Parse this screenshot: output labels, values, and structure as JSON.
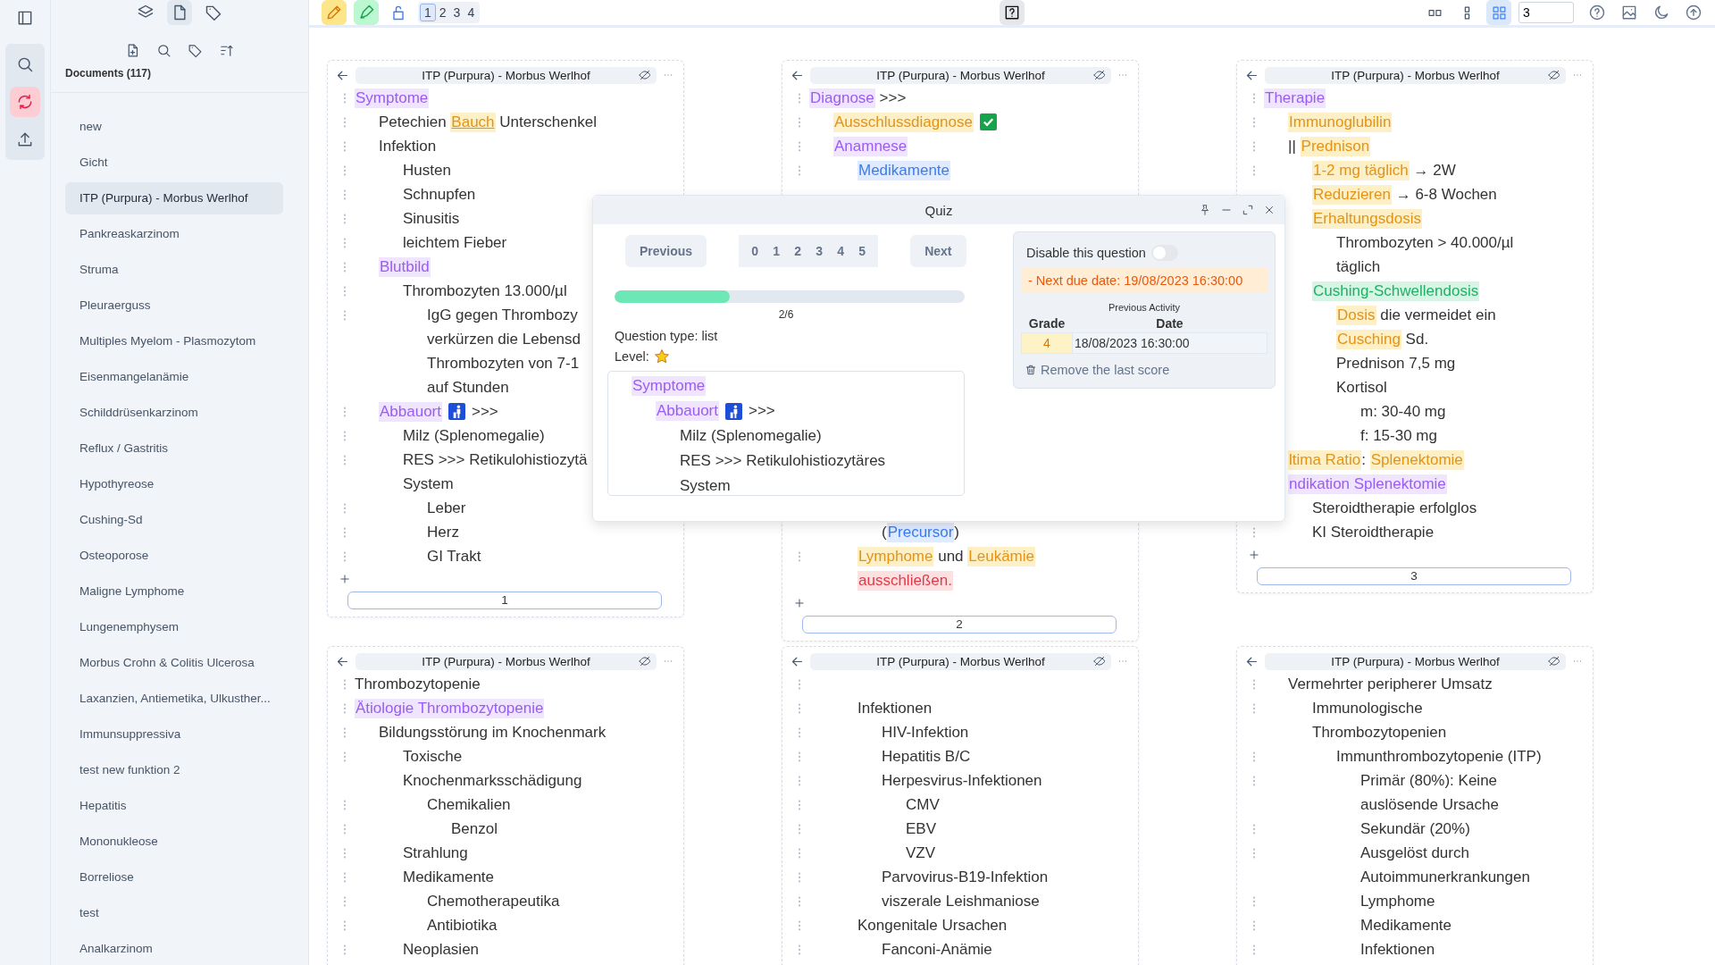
{
  "rail_tools": [
    {
      "kind": "search",
      "selected": false
    },
    {
      "kind": "refresh",
      "selected": true
    },
    {
      "kind": "upload",
      "selected": false
    }
  ],
  "list_tabs": [
    {
      "kind": "layers",
      "selected": false
    },
    {
      "kind": "document",
      "selected": true
    },
    {
      "kind": "tag",
      "selected": false
    }
  ],
  "list_tools": [
    {
      "kind": "document-plus"
    },
    {
      "kind": "search"
    },
    {
      "kind": "tag"
    },
    {
      "kind": "sort"
    }
  ],
  "documents_heading": "Documents (117)",
  "documents": [
    {
      "label": "new",
      "selected": false
    },
    {
      "label": "Gicht",
      "selected": false
    },
    {
      "label": "ITP (Purpura) - Morbus Werlhof",
      "selected": true
    },
    {
      "label": "Pankreaskarzinom",
      "selected": false
    },
    {
      "label": "Struma",
      "selected": false
    },
    {
      "label": "Pleuraerguss",
      "selected": false
    },
    {
      "label": "Multiples Myelom - Plasmozytom",
      "selected": false
    },
    {
      "label": "Eisenmangelanämie",
      "selected": false
    },
    {
      "label": "Schilddrüsenkarzinom",
      "selected": false
    },
    {
      "label": "Reflux / Gastritis",
      "selected": false
    },
    {
      "label": "Hypothyreose",
      "selected": false
    },
    {
      "label": "Cushing-Sd",
      "selected": false
    },
    {
      "label": "Osteoporose",
      "selected": false
    },
    {
      "label": "Maligne Lymphome",
      "selected": false
    },
    {
      "label": "Lungenemphysem",
      "selected": false
    },
    {
      "label": "Morbus Crohn & Colitis Ulcerosa",
      "selected": false
    },
    {
      "label": "Laxanzien, Antiemetika, Ulkusther...",
      "selected": false
    },
    {
      "label": "Immunsuppressiva",
      "selected": false
    },
    {
      "label": "test new funktion 2",
      "selected": false
    },
    {
      "label": "Hepatitis",
      "selected": false
    },
    {
      "label": "Mononukleose",
      "selected": false
    },
    {
      "label": "Borreliose",
      "selected": false
    },
    {
      "label": "test",
      "selected": false
    },
    {
      "label": "Analkarzinom",
      "selected": false
    }
  ],
  "editor_tools": [
    {
      "kind": "pencil"
    },
    {
      "kind": "marker"
    },
    {
      "kind": "lock"
    }
  ],
  "pages": [
    {
      "label": "1",
      "selected": true
    },
    {
      "label": "2",
      "selected": false
    },
    {
      "label": "3",
      "selected": false
    },
    {
      "label": "4",
      "selected": false
    }
  ],
  "layouts": [
    {
      "kind": "layout-split",
      "selected": false
    },
    {
      "kind": "layout-stack",
      "selected": false
    },
    {
      "kind": "layout-grid",
      "selected": true
    }
  ],
  "columns_value": "3",
  "right_tools": [
    {
      "kind": "help"
    },
    {
      "kind": "image"
    },
    {
      "kind": "moon"
    },
    {
      "kind": "upload-circle"
    }
  ],
  "panels": [
    {
      "title": "ITP (Purpura) - Morbus Werlhof",
      "show_add": true,
      "page": "1",
      "outline": [
        {
          "handle": true,
          "parts": [
            {
              "text": "Symptome",
              "kind": "purple"
            }
          ],
          "children": [
            {
              "handle": true,
              "parts": [
                {
                  "text": "Petechien ",
                  "kind": "plain"
                },
                {
                  "text": "Bauch",
                  "kind": "underline"
                },
                {
                  "text": " Unterschenkel",
                  "kind": "plain"
                }
              ]
            },
            {
              "handle": true,
              "parts": [
                {
                  "text": "Infektion",
                  "kind": "plain"
                }
              ],
              "children": [
                {
                  "handle": true,
                  "parts": [
                    {
                      "text": "Husten",
                      "kind": "plain"
                    }
                  ]
                },
                {
                  "handle": true,
                  "parts": [
                    {
                      "text": "Schnupfen",
                      "kind": "plain"
                    }
                  ]
                },
                {
                  "handle": true,
                  "parts": [
                    {
                      "text": "Sinusitis",
                      "kind": "plain"
                    }
                  ]
                },
                {
                  "handle": true,
                  "parts": [
                    {
                      "text": "leichtem Fieber",
                      "kind": "plain"
                    }
                  ]
                }
              ]
            },
            {
              "handle": true,
              "parts": [
                {
                  "text": "Blutbild",
                  "kind": "purple"
                }
              ],
              "children": [
                {
                  "handle": true,
                  "parts": [
                    {
                      "text": "Thrombozyten 13.000/µl",
                      "kind": "plain"
                    }
                  ],
                  "children": [
                    {
                      "handle": true,
                      "parts": [
                        {
                          "text": "IgG gegen Thrombozy",
                          "kind": "plain"
                        }
                      ]
                    },
                    {
                      "handle": false,
                      "parts": [
                        {
                          "text": "verkürzen die Lebensd",
                          "kind": "plain"
                        }
                      ]
                    },
                    {
                      "handle": false,
                      "parts": [
                        {
                          "text": "Thrombozyten von 7-1",
                          "kind": "plain"
                        }
                      ]
                    },
                    {
                      "handle": false,
                      "parts": [
                        {
                          "text": "auf Stunden",
                          "kind": "plain"
                        }
                      ]
                    }
                  ]
                }
              ]
            },
            {
              "handle": true,
              "parts": [
                {
                  "text": "Abbauort",
                  "kind": "purple"
                },
                {
                  "kind": "litter"
                },
                {
                  "text": ">>>",
                  "kind": "plain"
                }
              ],
              "children": [
                {
                  "handle": true,
                  "parts": [
                    {
                      "text": "Milz (Splenomegalie)",
                      "kind": "plain"
                    }
                  ]
                },
                {
                  "handle": true,
                  "parts": [
                    {
                      "text": "RES >>> Retikulohistiozytä",
                      "kind": "plain"
                    }
                  ]
                },
                {
                  "handle": false,
                  "parts": [
                    {
                      "text": "System",
                      "kind": "plain"
                    }
                  ],
                  "children": [
                    {
                      "handle": true,
                      "parts": [
                        {
                          "text": "Leber",
                          "kind": "plain"
                        }
                      ]
                    },
                    {
                      "handle": true,
                      "parts": [
                        {
                          "text": "Herz",
                          "kind": "plain"
                        }
                      ]
                    },
                    {
                      "handle": true,
                      "parts": [
                        {
                          "text": "GI Trakt",
                          "kind": "plain"
                        }
                      ]
                    }
                  ]
                }
              ]
            }
          ]
        }
      ]
    },
    {
      "title": "ITP (Purpura) - Morbus Werlhof",
      "show_add": true,
      "page": "2",
      "outline": [
        {
          "handle": true,
          "parts": [
            {
              "text": "Diagnose",
              "kind": "purple"
            },
            {
              "text": " >>>",
              "kind": "plain"
            }
          ],
          "children": [
            {
              "handle": true,
              "parts": [
                {
                  "text": "Ausschlussdiagnose",
                  "kind": "orange"
                },
                {
                  "kind": "check"
                }
              ]
            },
            {
              "handle": true,
              "parts": [
                {
                  "text": "Anamnese",
                  "kind": "purple"
                }
              ],
              "children": [
                {
                  "handle": true,
                  "parts": [
                    {
                      "text": "Medikamente",
                      "kind": "blue"
                    }
                  ]
                }
              ]
            }
          ]
        },
        {
          "children": [
            {
              "children": [
                {
                  "children": [
                    {
                      "handle": false,
                      "parts": [
                        {
                          "text": "(",
                          "kind": "plain"
                        },
                        {
                          "text": "Precursor",
                          "kind": "blue"
                        },
                        {
                          "text": ")",
                          "kind": "plain"
                        }
                      ]
                    }
                  ]
                },
                {
                  "handle": true,
                  "parts": [
                    {
                      "text": "Lymphome",
                      "kind": "orange"
                    },
                    {
                      "text": " und ",
                      "kind": "plain"
                    },
                    {
                      "text": "Leukämie",
                      "kind": "orange"
                    }
                  ]
                },
                {
                  "handle": false,
                  "parts": [
                    {
                      "text": "ausschließen.",
                      "kind": "red"
                    }
                  ]
                }
              ]
            }
          ]
        }
      ]
    },
    {
      "title": "ITP (Purpura) - Morbus Werlhof",
      "show_add": true,
      "page": "3",
      "outline": [
        {
          "handle": true,
          "parts": [
            {
              "text": "Therapie",
              "kind": "purple"
            }
          ],
          "children": [
            {
              "handle": true,
              "parts": [
                {
                  "text": "Immunoglubilin",
                  "kind": "orange"
                }
              ]
            },
            {
              "handle": true,
              "parts": [
                {
                  "text": "|| ",
                  "kind": "plain"
                },
                {
                  "text": "Prednison",
                  "kind": "orange"
                }
              ],
              "children": [
                {
                  "handle": true,
                  "parts": [
                    {
                      "text": "1-2 mg täglich",
                      "kind": "orange"
                    },
                    {
                      "text": " → 2W",
                      "kind": "plain"
                    }
                  ]
                },
                {
                  "handle": false,
                  "parts": [
                    {
                      "text": "Reduzieren",
                      "kind": "orange"
                    },
                    {
                      "text": " → 6-8 Wochen",
                      "kind": "plain"
                    }
                  ]
                },
                {
                  "handle": false,
                  "parts": [
                    {
                      "text": "Erhaltungsdosis",
                      "kind": "orange"
                    }
                  ],
                  "children": [
                    {
                      "handle": false,
                      "parts": [
                        {
                          "text": "Thrombozyten > 40.000/µl",
                          "kind": "plain"
                        }
                      ]
                    },
                    {
                      "handle": false,
                      "parts": [
                        {
                          "text": "täglich",
                          "kind": "plain"
                        }
                      ]
                    }
                  ]
                },
                {
                  "handle": false,
                  "parts": [
                    {
                      "text": "Cushing-Schwellendosis",
                      "kind": "green"
                    }
                  ],
                  "children": [
                    {
                      "handle": false,
                      "parts": [
                        {
                          "text": "Dosis",
                          "kind": "orange"
                        },
                        {
                          "text": " die vermeidet ein",
                          "kind": "plain"
                        }
                      ]
                    },
                    {
                      "handle": false,
                      "parts": [
                        {
                          "text": "Cusching",
                          "kind": "orange"
                        },
                        {
                          "text": " Sd.",
                          "kind": "plain"
                        }
                      ]
                    },
                    {
                      "handle": false,
                      "parts": [
                        {
                          "text": "Prednison 7,5 mg",
                          "kind": "plain"
                        }
                      ]
                    },
                    {
                      "handle": false,
                      "parts": [
                        {
                          "text": "Kortisol",
                          "kind": "plain"
                        }
                      ],
                      "children": [
                        {
                          "handle": false,
                          "parts": [
                            {
                              "text": "m: 30-40 mg",
                              "kind": "plain"
                            }
                          ]
                        },
                        {
                          "handle": false,
                          "parts": [
                            {
                              "text": "f: 15-30 mg",
                              "kind": "plain"
                            }
                          ]
                        }
                      ]
                    }
                  ]
                }
              ]
            },
            {
              "handle": false,
              "parts": [
                {
                  "text": "ltima Ratio",
                  "kind": "orange"
                },
                {
                  "text": ": ",
                  "kind": "plain"
                },
                {
                  "text": "Splenektomie",
                  "kind": "orange"
                }
              ]
            },
            {
              "handle": false,
              "parts": [
                {
                  "text": "ndikation Splenektomie",
                  "kind": "purple"
                }
              ],
              "children": [
                {
                  "handle": false,
                  "parts": [
                    {
                      "text": "Steroidtherapie erfolglos",
                      "kind": "plain"
                    }
                  ]
                },
                {
                  "handle": true,
                  "parts": [
                    {
                      "text": "KI Steroidtherapie",
                      "kind": "plain"
                    }
                  ]
                }
              ]
            }
          ]
        }
      ]
    },
    {
      "title": "ITP (Purpura) - Morbus Werlhof",
      "show_add": false,
      "outline": [
        {
          "handle": true,
          "parts": [
            {
              "text": "Thrombozytopenie",
              "kind": "plain"
            }
          ]
        },
        {
          "handle": true,
          "parts": [
            {
              "text": "Ätiologie Thrombozytopenie",
              "kind": "purple"
            }
          ],
          "children": [
            {
              "handle": true,
              "parts": [
                {
                  "text": "Bildungsstörung im Knochenmark",
                  "kind": "plain"
                }
              ],
              "children": [
                {
                  "handle": true,
                  "parts": [
                    {
                      "text": "Toxische",
                      "kind": "plain"
                    }
                  ]
                },
                {
                  "handle": false,
                  "parts": [
                    {
                      "text": "Knochenmarksschädigung",
                      "kind": "plain"
                    }
                  ],
                  "children": [
                    {
                      "handle": true,
                      "parts": [
                        {
                          "text": "Chemikalien",
                          "kind": "plain"
                        }
                      ],
                      "children": [
                        {
                          "handle": true,
                          "parts": [
                            {
                              "text": "Benzol",
                              "kind": "plain"
                            }
                          ]
                        }
                      ]
                    }
                  ]
                },
                {
                  "handle": true,
                  "parts": [
                    {
                      "text": "Strahlung",
                      "kind": "plain"
                    }
                  ]
                },
                {
                  "handle": true,
                  "parts": [
                    {
                      "text": "Medikamente",
                      "kind": "plain"
                    }
                  ],
                  "children": [
                    {
                      "handle": true,
                      "parts": [
                        {
                          "text": "Chemotherapeutika",
                          "kind": "plain"
                        }
                      ]
                    },
                    {
                      "handle": true,
                      "parts": [
                        {
                          "text": "Antibiotika",
                          "kind": "plain"
                        }
                      ]
                    }
                  ]
                },
                {
                  "handle": true,
                  "parts": [
                    {
                      "text": "Neoplasien",
                      "kind": "plain"
                    }
                  ]
                }
              ]
            }
          ]
        }
      ]
    },
    {
      "title": "ITP (Purpura) - Morbus Werlhof",
      "show_add": false,
      "outline": [
        {
          "handle": true,
          "children": [
            {
              "children": [
                {
                  "handle": true,
                  "parts": [
                    {
                      "text": "Infektionen",
                      "kind": "plain"
                    }
                  ],
                  "children": [
                    {
                      "handle": true,
                      "parts": [
                        {
                          "text": "HIV-Infektion",
                          "kind": "plain"
                        }
                      ]
                    },
                    {
                      "handle": true,
                      "parts": [
                        {
                          "text": "Hepatitis B/C",
                          "kind": "plain"
                        }
                      ]
                    },
                    {
                      "handle": true,
                      "parts": [
                        {
                          "text": "Herpesvirus-Infektionen",
                          "kind": "plain"
                        }
                      ],
                      "children": [
                        {
                          "handle": true,
                          "parts": [
                            {
                              "text": "CMV",
                              "kind": "plain"
                            }
                          ]
                        },
                        {
                          "handle": true,
                          "parts": [
                            {
                              "text": "EBV",
                              "kind": "plain"
                            }
                          ]
                        },
                        {
                          "handle": true,
                          "parts": [
                            {
                              "text": "VZV",
                              "kind": "plain"
                            }
                          ]
                        }
                      ]
                    },
                    {
                      "handle": true,
                      "parts": [
                        {
                          "text": "Parvovirus-B19-Infektion",
                          "kind": "plain"
                        }
                      ]
                    },
                    {
                      "handle": true,
                      "parts": [
                        {
                          "text": "viszerale Leishmaniose",
                          "kind": "plain"
                        }
                      ]
                    }
                  ]
                },
                {
                  "handle": true,
                  "parts": [
                    {
                      "text": "Kongenitale Ursachen",
                      "kind": "plain"
                    }
                  ],
                  "children": [
                    {
                      "handle": true,
                      "parts": [
                        {
                          "text": "Fanconi-Anämie",
                          "kind": "plain"
                        }
                      ]
                    }
                  ]
                }
              ]
            }
          ]
        }
      ]
    },
    {
      "title": "ITP (Purpura) - Morbus Werlhof",
      "show_add": false,
      "outline": [
        {
          "children": [
            {
              "handle": true,
              "parts": [
                {
                  "text": "Vermehrter peripherer Umsatz",
                  "kind": "plain"
                }
              ],
              "children": [
                {
                  "handle": true,
                  "parts": [
                    {
                      "text": "Immunologische",
                      "kind": "plain"
                    }
                  ]
                },
                {
                  "handle": false,
                  "parts": [
                    {
                      "text": "Thrombozytopenien",
                      "kind": "plain"
                    }
                  ],
                  "children": [
                    {
                      "handle": true,
                      "parts": [
                        {
                          "text": "Immunthrombozytopenie (ITP)",
                          "kind": "plain"
                        }
                      ],
                      "children": [
                        {
                          "handle": true,
                          "parts": [
                            {
                              "text": "Primär (80%): Keine",
                              "kind": "plain"
                            }
                          ]
                        },
                        {
                          "handle": false,
                          "parts": [
                            {
                              "text": "auslösende Ursache",
                              "kind": "plain"
                            }
                          ]
                        },
                        {
                          "handle": true,
                          "parts": [
                            {
                              "text": "Sekundär (20%)",
                              "kind": "plain"
                            }
                          ]
                        },
                        {
                          "handle": true,
                          "parts": [
                            {
                              "text": "Ausgelöst durch",
                              "kind": "plain"
                            }
                          ]
                        },
                        {
                          "handle": false,
                          "parts": [
                            {
                              "text": "Autoimmunerkrankungen",
                              "kind": "plain"
                            }
                          ]
                        },
                        {
                          "handle": true,
                          "parts": [
                            {
                              "text": "Lymphome",
                              "kind": "plain"
                            }
                          ]
                        },
                        {
                          "handle": true,
                          "parts": [
                            {
                              "text": "Medikamente",
                              "kind": "plain"
                            }
                          ]
                        },
                        {
                          "handle": true,
                          "parts": [
                            {
                              "text": "Infektionen",
                              "kind": "plain"
                            }
                          ]
                        }
                      ]
                    }
                  ]
                }
              ]
            }
          ]
        }
      ]
    }
  ],
  "quiz": {
    "title": "Quiz",
    "previous": "Previous",
    "next": "Next",
    "grades": [
      "0",
      "1",
      "2",
      "3",
      "4",
      "5"
    ],
    "progress": {
      "level": 0.33,
      "label": "2/6"
    },
    "question_type": "Question type: list",
    "level_label": "Level:",
    "preview": [
      {
        "parts": [
          {
            "text": "Symptome",
            "kind": "purple"
          }
        ],
        "children": [
          {
            "parts": [
              {
                "text": "Abbauort",
                "kind": "purple"
              },
              {
                "kind": "litter"
              },
              {
                "text": ">>>",
                "kind": "plain"
              }
            ],
            "children": [
              {
                "parts": [
                  {
                    "text": "Milz (Splenomegalie)",
                    "kind": "plain"
                  }
                ]
              },
              {
                "parts": [
                  {
                    "text": "RES >>> Retikulohistiozytäres",
                    "kind": "plain"
                  }
                ]
              },
              {
                "parts": [
                  {
                    "text": "System",
                    "kind": "plain"
                  }
                ]
              }
            ]
          }
        ]
      }
    ],
    "disable": {
      "label": "Disable this question",
      "on": false
    },
    "due": "- Next due date: 19/08/2023 16:30:00",
    "activity": {
      "title": "Previous Activity",
      "columns": [
        "Grade",
        "Date"
      ],
      "rows": [
        [
          "4",
          "18/08/2023 16:30:00"
        ]
      ]
    },
    "remove": "Remove the last score"
  }
}
